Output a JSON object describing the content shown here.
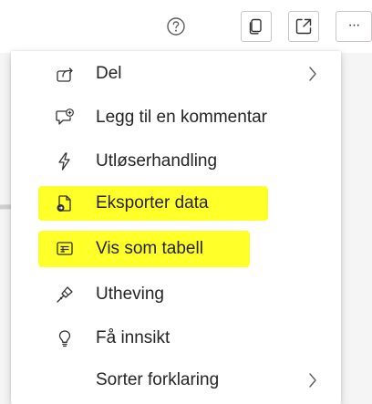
{
  "toolbar": {
    "help_icon": "question-circle-icon",
    "copy_icon": "copy-icon",
    "focus_icon": "focus-mode-icon",
    "more_icon": "more-options-icon",
    "more_label": "···"
  },
  "menu": {
    "items": [
      {
        "label": "Del",
        "icon": "share-icon",
        "has_submenu": true,
        "highlighted": false
      },
      {
        "label": "Legg til en kommentar",
        "icon": "comment-add-icon",
        "has_submenu": false,
        "highlighted": false
      },
      {
        "label": "Utløserhandling",
        "icon": "lightning-icon",
        "has_submenu": false,
        "highlighted": false
      },
      {
        "label": "Eksporter data",
        "icon": "export-data-icon",
        "has_submenu": false,
        "highlighted": true
      },
      {
        "label": "Vis som tabell",
        "icon": "table-view-icon",
        "has_submenu": false,
        "highlighted": true
      },
      {
        "label": "Utheving",
        "icon": "spotlight-icon",
        "has_submenu": false,
        "highlighted": false
      },
      {
        "label": "Få innsikt",
        "icon": "lightbulb-icon",
        "has_submenu": false,
        "highlighted": false
      },
      {
        "label": "Sorter forklaring",
        "icon": "",
        "has_submenu": true,
        "highlighted": false
      }
    ]
  },
  "colors": {
    "highlight": "#ffff2a",
    "text": "#252423",
    "icon": "#323130"
  }
}
